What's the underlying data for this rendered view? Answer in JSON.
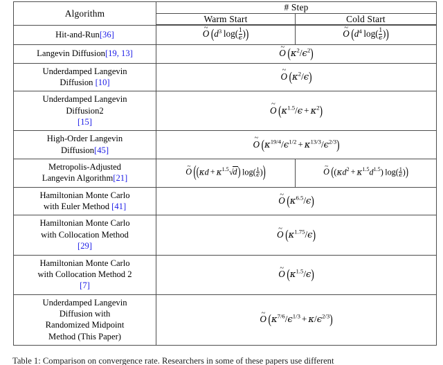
{
  "document": {
    "type": "paper-table-figure",
    "caption_partial": "Table 1: Comparison on convergence rate. Researchers in some of these papers use different",
    "cite_color": "#1a1ae6",
    "rule_color": "#4c4c4c"
  },
  "table": {
    "header": {
      "algorithm": "Algorithm",
      "step_group": "# Step",
      "warm_start": "Warm Start",
      "cold_start": "Cold Start"
    },
    "columns": [
      "Algorithm",
      "Warm Start",
      "Cold Start"
    ],
    "rows": [
      {
        "algorithm_lines": [
          "Hit-and-Run"
        ],
        "citation": "[36]",
        "citation_inline": true,
        "span": false,
        "warm": "O~ ( d^3 log(1/ϵ) )",
        "cold": "O~ ( d^4 log(1/ϵ) )"
      },
      {
        "algorithm_lines": [
          "Langevin Diffusion"
        ],
        "citation": "[19, 13]",
        "citation_inline": true,
        "span": true,
        "formula": "O~ ( κ^2/ϵ^2 )"
      },
      {
        "algorithm_lines": [
          "Underdamped Langevin",
          "Diffusion"
        ],
        "citation": "[10]",
        "citation_inline": true,
        "span": true,
        "formula": "O~ ( κ^2/ϵ )"
      },
      {
        "algorithm_lines": [
          "Underdamped Langevin",
          "Diffusion2"
        ],
        "citation": "[15]",
        "citation_inline": false,
        "span": true,
        "formula": "O~ ( κ^1.5/ϵ + κ^2 )"
      },
      {
        "algorithm_lines": [
          "High-Order Langevin",
          "Diffusion"
        ],
        "citation": "[45]",
        "citation_inline": true,
        "span": true,
        "formula": "O~ ( κ^{19/4}/ϵ^{1/2} + κ^{13/3}/ϵ^{2/3} )"
      },
      {
        "algorithm_lines": [
          "Metropolis-Adjusted",
          "Langevin Algorithm"
        ],
        "citation": "[21]",
        "citation_inline": true,
        "span": false,
        "warm": "O~ ( ( κd + κ^1.5 √d ) log(1/ϵ) )",
        "cold": "O~ ( ( κd^2 + κ^1.5 d^1.5 ) log(1/ϵ) )"
      },
      {
        "algorithm_lines": [
          "Hamiltonian Monte Carlo",
          "with Euler Method"
        ],
        "citation": "[41]",
        "citation_inline": true,
        "span": true,
        "formula": "O~ ( κ^{6.5}/ϵ )"
      },
      {
        "algorithm_lines": [
          "Hamiltonian Monte Carlo",
          "with Collocation Method"
        ],
        "citation": "[29]",
        "citation_inline": false,
        "span": true,
        "formula": "O~ ( κ^{1.75}/ϵ )"
      },
      {
        "algorithm_lines": [
          "Hamiltonian Monte Carlo",
          "with Collocation Method 2"
        ],
        "citation": "[7]",
        "citation_inline": false,
        "span": true,
        "formula": "O~ ( κ^{1.5}/ϵ )"
      },
      {
        "algorithm_lines": [
          "Underdamped Langevin",
          "Diffusion with",
          "Randomized Midpoint",
          "Method (This Paper)"
        ],
        "citation": "",
        "citation_inline": false,
        "span": true,
        "formula": "O~ ( κ^{7/6}/ϵ^{1/3} + κ/ϵ^{2/3} )"
      }
    ]
  },
  "labels": {
    "hit_and_run": "Hit-and-Run",
    "langevin_diffusion": "Langevin Diffusion",
    "underdamped_l1": "Underdamped Langevin",
    "diffusion": "Diffusion",
    "diffusion2": "Diffusion2",
    "high_order_l1": "High-Order Langevin",
    "mala_l1": "Metropolis-Adjusted",
    "mala_l2": "Langevin Algorithm",
    "hmc_l1": "Hamiltonian Monte Carlo",
    "hmc_euler_l2": "with Euler Method",
    "hmc_coll_l2": "with Collocation Method",
    "hmc_coll2_l2": "with Collocation Method 2",
    "udl_rm_l2": "Diffusion with",
    "udl_rm_l3": "Randomized Midpoint",
    "udl_rm_l4": "Method (This Paper)"
  },
  "citations": {
    "c36": "[36]",
    "c19_13": "[19, 13]",
    "c10": "[10]",
    "c15": "[15]",
    "c45": "[45]",
    "c21": "[21]",
    "c41": "[41]",
    "c29": "[29]",
    "c7": "[7]"
  }
}
